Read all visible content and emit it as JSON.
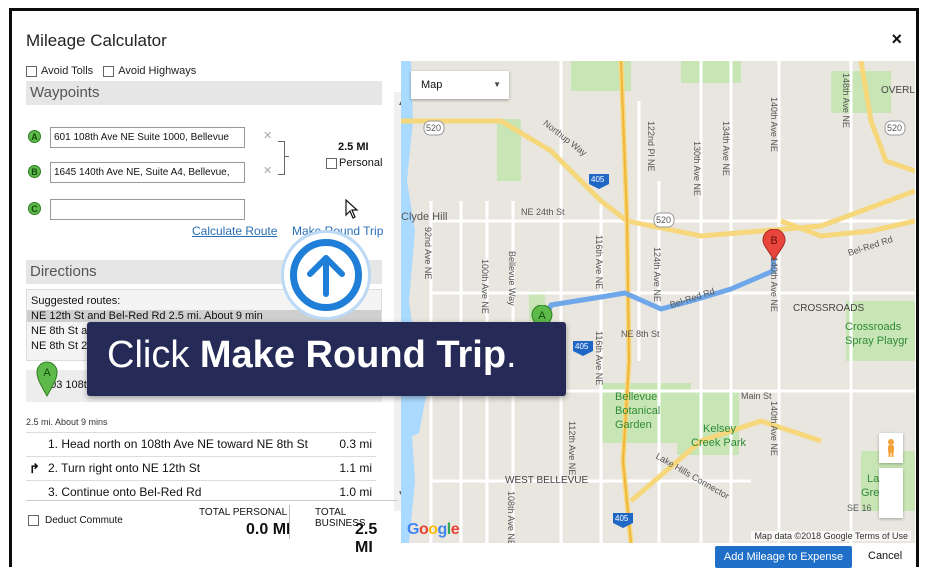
{
  "dialog": {
    "title": "Mileage Calculator",
    "close": "×"
  },
  "options": {
    "avoid_tolls": "Avoid Tolls",
    "avoid_highways": "Avoid Highways"
  },
  "waypoints": {
    "header": "Waypoints",
    "items": [
      {
        "marker": "A",
        "value": "601 108th Ave NE Suite 1000, Bellevue"
      },
      {
        "marker": "B",
        "value": "1645 140th Ave NE, Suite A4, Bellevue,"
      },
      {
        "marker": "C",
        "value": ""
      }
    ],
    "distance": "2.5 MI",
    "personal_label": "Personal",
    "calculate_route": "Calculate Route",
    "make_round_trip": "Make Round Trip"
  },
  "directions": {
    "header": "Directions",
    "suggested_label": "Suggested routes:",
    "routes": [
      "NE 12th St and Bel-Red Rd 2.5 mi. About 9 min",
      "NE 8th St and Bel-Red Rd 2.9 mi. About 9 min",
      "NE 8th St 2.8 mi. About 10 min"
    ],
    "start_address": "703 108th Ave NE",
    "summary": "2.5 mi. About 9 mins",
    "steps": [
      {
        "text": "1.  Head north on 108th Ave NE toward NE 8th St",
        "dist": "0.3 mi"
      },
      {
        "text": "2.  Turn right onto NE 12th St",
        "dist": "1.1 mi"
      },
      {
        "text": "3.  Continue onto Bel-Red Rd",
        "dist": "1.0 mi"
      }
    ]
  },
  "totals": {
    "deduct_commute": "Deduct Commute",
    "personal_label": "TOTAL PERSONAL",
    "personal_value": "0.0 MI",
    "business_label": "TOTAL BUSINESS",
    "business_value": "2.5 MI"
  },
  "map": {
    "type_label": "Map",
    "labels": {
      "overlake": "OVERL",
      "clyde_hill": "Clyde Hill",
      "crossroads": "CROSSROADS",
      "crossroads_park": "Crossroads",
      "spray_park": "Spray Playgr",
      "bellevue_botanical": "Bellevue",
      "botanical": "Botanical",
      "garden": "Garden",
      "kelsey": "Kelsey",
      "creek_park": "Creek Park",
      "west_bellevue": "WEST BELLEVUE",
      "ne24": "NE 24th St",
      "ne8": "NE 8th St",
      "main": "Main St",
      "belred": "Bel-Red Rd",
      "northup": "Northup Way",
      "lake_hills": "Lake Hills Connector",
      "ave140": "140th Ave NE",
      "ave148": "148th Ave NE",
      "ave134": "134th Ave NE",
      "ave130": "130th Ave NE",
      "ave124": "124th Ave NE",
      "ave122": "122nd Pl NE",
      "ave116": "116th Ave NE",
      "ave112": "112th Ave NE",
      "ave108": "108th Ave NE",
      "ave100": "100th Ave NE",
      "ave92": "92nd Ave NE",
      "bellevue_way": "Bellevue Way",
      "se16": "SE 16",
      "hwy520": "520",
      "hwy405": "405",
      "lake_partial": "La",
      "green_partial": "Green"
    },
    "attribution": "Map data ©2018 Google   Terms of Use",
    "google": [
      "G",
      "o",
      "o",
      "g",
      "l",
      "e"
    ],
    "google_colors": [
      "#4285f4",
      "#ea4335",
      "#fbbc05",
      "#4285f4",
      "#34a853",
      "#ea4335"
    ],
    "markers": {
      "a": "A",
      "b": "B"
    }
  },
  "callout": {
    "prefix": "Click ",
    "action": "Make Round Trip",
    "suffix": "."
  },
  "footer": {
    "add_button": "Add Mileage to Expense",
    "cancel": "Cancel"
  }
}
